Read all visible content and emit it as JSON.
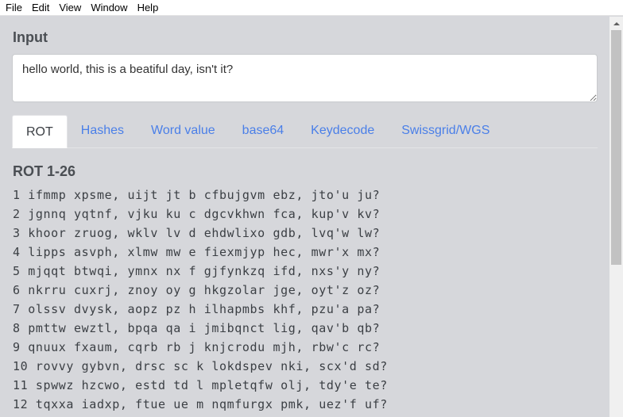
{
  "menu": {
    "items": [
      "File",
      "Edit",
      "View",
      "Window",
      "Help"
    ]
  },
  "input": {
    "title": "Input",
    "value": "hello world, this is a beatiful day, isn't it?"
  },
  "tabs": [
    {
      "label": "ROT",
      "active": true
    },
    {
      "label": "Hashes",
      "active": false
    },
    {
      "label": "Word value",
      "active": false
    },
    {
      "label": "base64",
      "active": false
    },
    {
      "label": "Keydecode",
      "active": false
    },
    {
      "label": "Swissgrid/WGS",
      "active": false
    }
  ],
  "rot": {
    "title": "ROT 1-26",
    "lines": [
      "1 ifmmp xpsme, uijt jt b cfbujgvm ebz, jto'u ju?",
      "2 jgnnq yqtnf, vjku ku c dgcvkhwn fca, kup'v kv?",
      "3 khoor zruog, wklv lv d ehdwlixo gdb, lvq'w lw?",
      "4 lipps asvph, xlmw mw e fiexmjyp hec, mwr'x mx?",
      "5 mjqqt btwqi, ymnx nx f gjfynkzq ifd, nxs'y ny?",
      "6 nkrru cuxrj, znoy oy g hkgzolar jge, oyt'z oz?",
      "7 olssv dvysk, aopz pz h ilhapmbs khf, pzu'a pa?",
      "8 pmttw ewztl, bpqa qa i jmibqnct lig, qav'b qb?",
      "9 qnuux fxaum, cqrb rb j knjcrodu mjh, rbw'c rc?",
      "10 rovvy gybvn, drsc sc k lokdspev nki, scx'd sd?",
      "11 spwwz hzcwo, estd td l mpletqfw olj, tdy'e te?",
      "12 tqxxa iadxp, ftue ue m nqmfurgx pmk, uez'f uf?"
    ]
  },
  "colors": {
    "background": "#d6d7db",
    "link": "#4a7fe8",
    "text": "#3b3f44"
  }
}
